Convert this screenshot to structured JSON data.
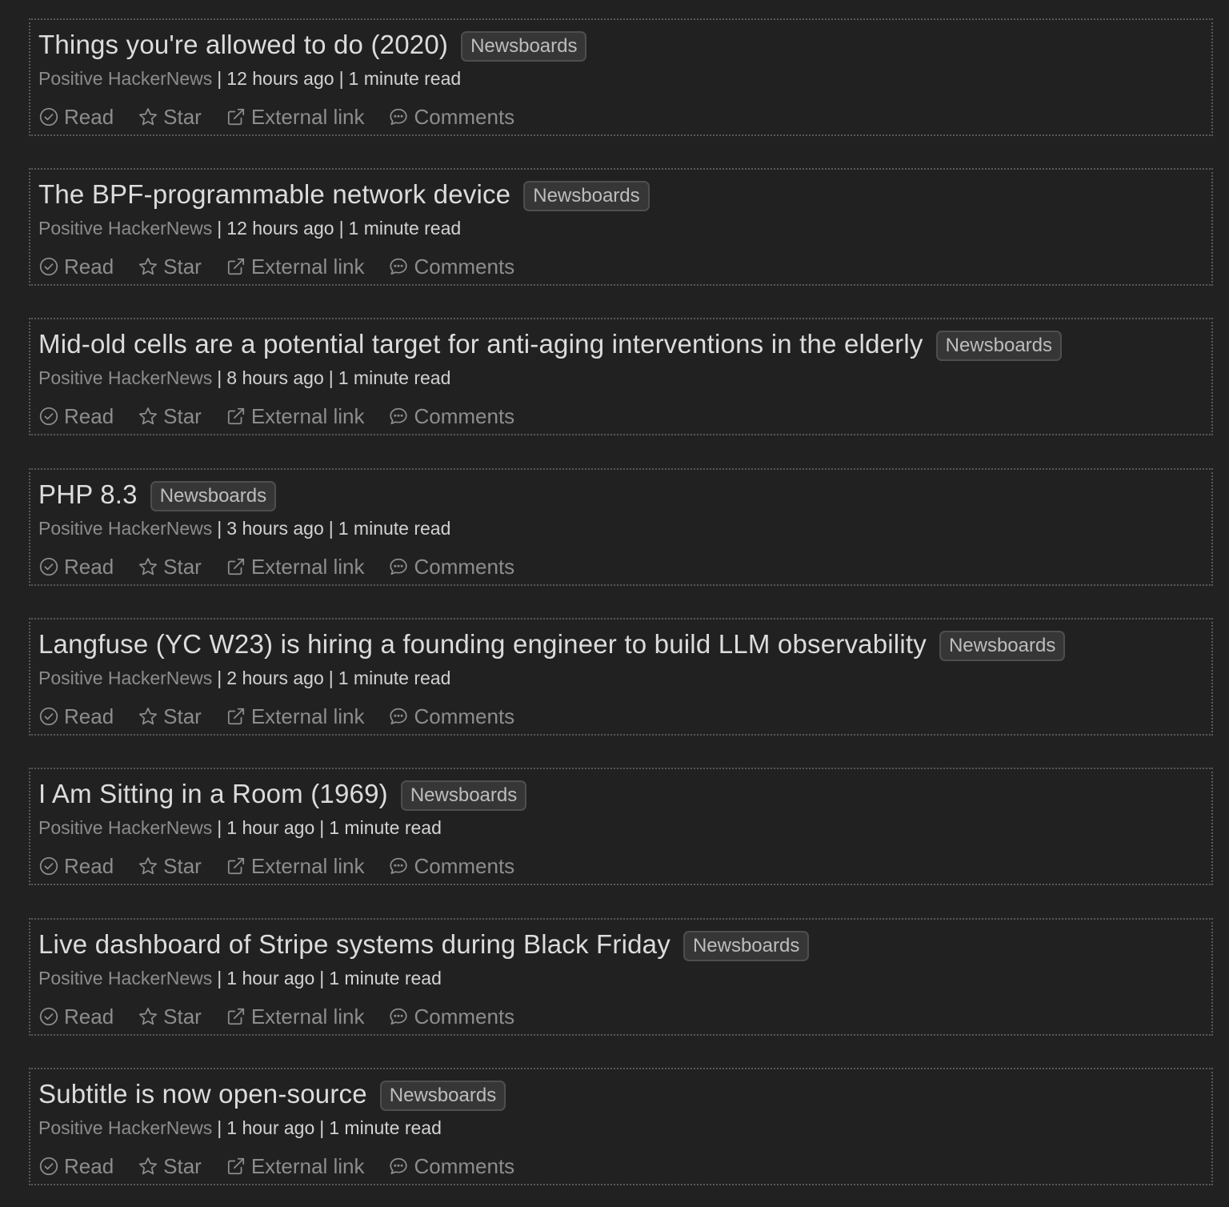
{
  "tag_label": "Newsboards",
  "source_label": "Positive HackerNews",
  "separator": "|",
  "actions": {
    "read": "Read",
    "star": "Star",
    "external": "External link",
    "comments": "Comments"
  },
  "articles": [
    {
      "title": "Things you're allowed to do (2020)",
      "age": "12 hours ago",
      "read_time": "1 minute read"
    },
    {
      "title": "The BPF-programmable network device",
      "age": "12 hours ago",
      "read_time": "1 minute read"
    },
    {
      "title": "Mid-old cells are a potential target for anti-aging interventions in the elderly",
      "age": "8 hours ago",
      "read_time": "1 minute read"
    },
    {
      "title": "PHP 8.3",
      "age": "3 hours ago",
      "read_time": "1 minute read"
    },
    {
      "title": "Langfuse (YC W23) is hiring a founding engineer to build LLM observability",
      "age": "2 hours ago",
      "read_time": "1 minute read"
    },
    {
      "title": "I Am Sitting in a Room (1969)",
      "age": "1 hour ago",
      "read_time": "1 minute read"
    },
    {
      "title": "Live dashboard of Stripe systems during Black Friday",
      "age": "1 hour ago",
      "read_time": "1 minute read"
    },
    {
      "title": "Subtitle is now open-source",
      "age": "1 hour ago",
      "read_time": "1 minute read"
    }
  ]
}
